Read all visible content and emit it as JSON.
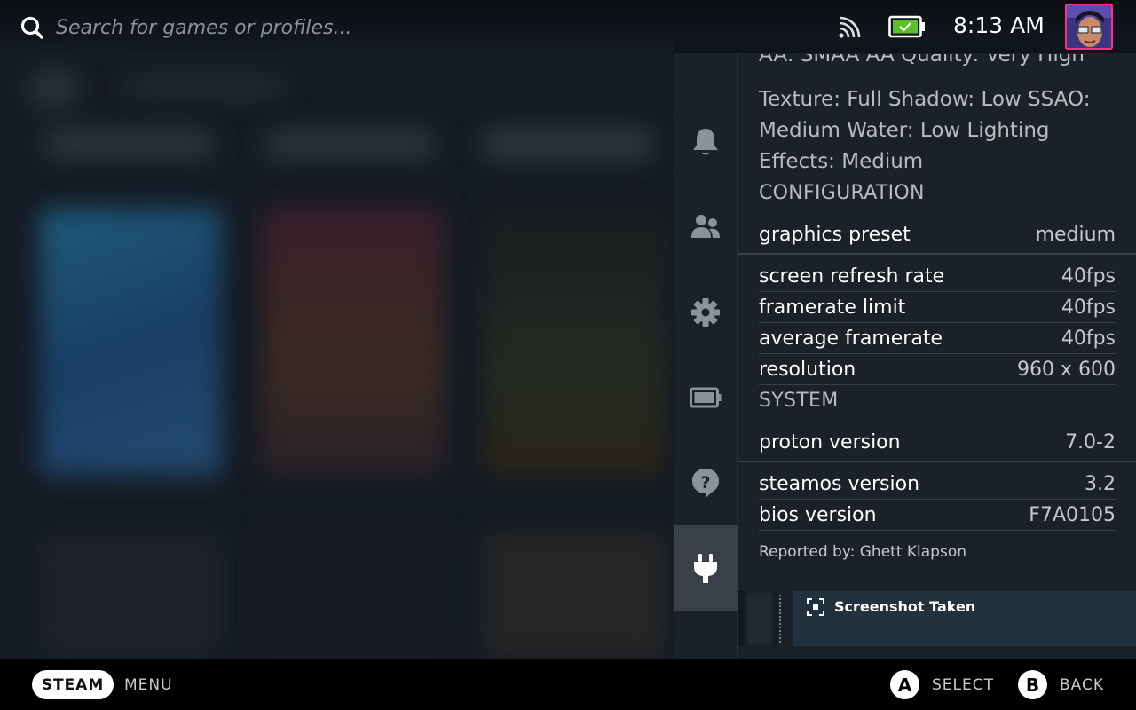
{
  "topbar": {
    "search_placeholder": "Search for games or profiles...",
    "time": "8:13 AM"
  },
  "side_menu": {
    "items": [
      {
        "icon": "bell-icon",
        "label": "Notifications"
      },
      {
        "icon": "friends-icon",
        "label": "Friends"
      },
      {
        "icon": "gear-icon",
        "label": "Settings"
      },
      {
        "icon": "battery-icon",
        "label": "Performance"
      },
      {
        "icon": "help-icon",
        "label": "Help"
      },
      {
        "icon": "plug-icon",
        "label": "Plugins",
        "active": true
      }
    ]
  },
  "report": {
    "partial_top": "AA: SMAA AA Quality: Very High",
    "spec_text_lines": [
      "Texture: Full Shadow: Low SSAO:",
      "Medium Water: Low Lighting",
      "Effects: Medium"
    ],
    "configuration_label": "CONFIGURATION",
    "graphics_preset": {
      "key": "graphics preset",
      "value": "medium"
    },
    "screen_refresh_rate": {
      "key": "screen refresh rate",
      "value": "40fps"
    },
    "framerate_limit": {
      "key": "framerate limit",
      "value": "40fps"
    },
    "average_framerate": {
      "key": "average framerate",
      "value": "40fps"
    },
    "resolution": {
      "key": "resolution",
      "value": "960 x 600"
    },
    "system_label": "SYSTEM",
    "proton_version": {
      "key": "proton version",
      "value": "7.0-2"
    },
    "steamos_version": {
      "key": "steamos version",
      "value": "3.2"
    },
    "bios_version": {
      "key": "bios version",
      "value": "F7A0105"
    },
    "reported_by": "Reported by: Ghett Klapson"
  },
  "toast": {
    "text": "Screenshot Taken"
  },
  "bottombar": {
    "steam_label": "STEAM",
    "menu_label": "MENU",
    "a_glyph": "A",
    "select_label": "SELECT",
    "b_glyph": "B",
    "back_label": "BACK"
  },
  "colors": {
    "accent_battery": "#5cbf2a",
    "avatar_border": "#ff2e8a",
    "panel_bg": "#1b2129"
  }
}
